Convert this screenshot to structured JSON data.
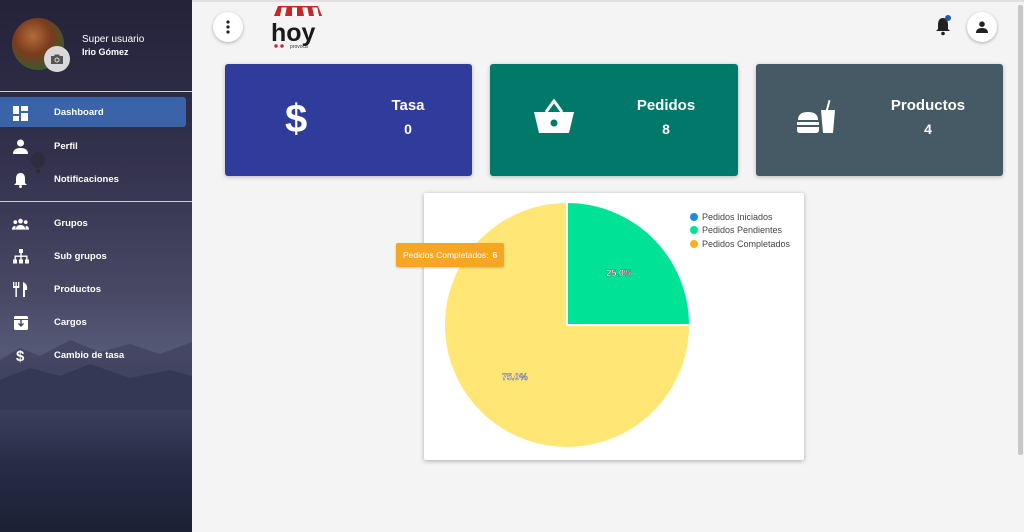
{
  "user": {
    "role": "Super usuario",
    "name": "Irio Gómez"
  },
  "sidebar": {
    "items": [
      {
        "label": "Dashboard",
        "icon": "dashboard-icon",
        "active": true
      },
      {
        "label": "Perfil",
        "icon": "person-icon"
      },
      {
        "label": "Notificaciones",
        "icon": "bell-icon"
      },
      {
        "label": "Grupos",
        "icon": "people-icon"
      },
      {
        "label": "Sub grupos",
        "icon": "hierarchy-icon"
      },
      {
        "label": "Productos",
        "icon": "restaurant-icon"
      },
      {
        "label": "Cargos",
        "icon": "archive-icon"
      },
      {
        "label": "Cambio de tasa",
        "icon": "dollar-icon"
      }
    ]
  },
  "header": {
    "logo_text": "hoy",
    "logo_subtext": "provoca"
  },
  "cards": [
    {
      "title": "Tasa",
      "value": "0",
      "icon": "dollar-icon",
      "color": "#303c9c"
    },
    {
      "title": "Pedidos",
      "value": "8",
      "icon": "basket-icon",
      "color": "#00796b"
    },
    {
      "title": "Productos",
      "value": "4",
      "icon": "fastfood-icon",
      "color": "#455a64"
    }
  ],
  "chart_data": {
    "type": "pie",
    "categories": [
      "Pedidos Iniciados",
      "Pedidos Pendientes",
      "Pedidos Completados"
    ],
    "values": [
      0,
      2,
      6
    ],
    "slice_labels": [
      "",
      "25.0%",
      "75.0%"
    ],
    "colors": [
      "#1e88e5",
      "#00e396",
      "#feb019"
    ],
    "slice_colors": [
      "#1e88e5",
      "#00e396",
      "#ffe675"
    ],
    "legend": "top-right"
  },
  "tooltip": {
    "label": "Pedidos Completados:",
    "value": "6"
  }
}
